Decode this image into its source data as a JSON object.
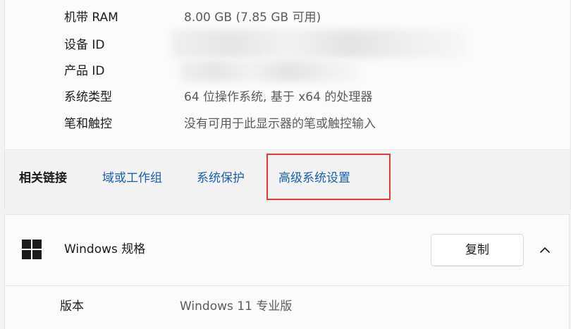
{
  "device_specs": {
    "rows": [
      {
        "label": "机带 RAM",
        "value": "8.00 GB (7.85 GB 可用)"
      },
      {
        "label": "设备 ID",
        "value": ""
      },
      {
        "label": "产品 ID",
        "value": ""
      },
      {
        "label": "系统类型",
        "value": "64 位操作系统, 基于 x64 的处理器"
      },
      {
        "label": "笔和触控",
        "value": "没有可用于此显示器的笔或触控输入"
      }
    ]
  },
  "related_links": {
    "label": "相关链接",
    "links": [
      "域或工作组",
      "系统保护",
      "高级系统设置"
    ]
  },
  "windows_spec": {
    "title": "Windows 规格",
    "copy_label": "复制",
    "icons": {
      "logo": "windows-logo-icon",
      "toggle": "chevron-up-icon"
    },
    "version_label": "版本",
    "version_value": "Windows 11 专业版"
  },
  "colors": {
    "link": "#1a5fb4",
    "highlight": "#e03c3c"
  }
}
